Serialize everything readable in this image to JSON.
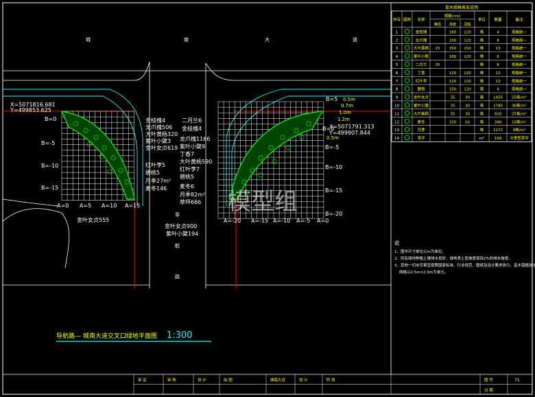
{
  "drawing": {
    "title": "导航路— 城南大道交叉口绿地平面图",
    "scale": "1:300",
    "watermark": "模型组",
    "road_label": [
      "城",
      "南",
      "大",
      "道"
    ],
    "road_label_vertical": [
      "导",
      "航",
      "路"
    ]
  },
  "left_plan": {
    "coord_x": "X=5071816.681",
    "coord_y": "Y=499853.625",
    "b_labels": [
      "B=0",
      "B=-5",
      "B=-10",
      "B=-15"
    ],
    "a_labels": [
      "A=0",
      "A=5",
      "A=10",
      "A=15"
    ],
    "dim_555": "金叶女贞555",
    "plant_callouts": [
      "金枝槐4",
      "龙爪槐506",
      "大叶黄杨320",
      "紫叶小檗3",
      "金叶女贞619",
      "红叶李5",
      "碧桃5",
      "月季27m²",
      "麦冬146"
    ]
  },
  "right_plan": {
    "coord_x": "X=5071791.313",
    "coord_y": "Y=499907.844",
    "b_labels": [
      "B=5",
      "B=0",
      "B=-5",
      "B=-10",
      "B=-15",
      "B=-20"
    ],
    "a_labels": [
      "A=-20",
      "A=-15",
      "A=-10",
      "A=-5",
      "A=0"
    ],
    "widths": [
      "0.5m",
      "0.7m",
      "1.0m",
      "1.2m",
      "0.5m"
    ],
    "plant_callouts": [
      "二月兰6",
      "金枝槐4",
      "龙爪槐1166",
      "紫叶小檗9",
      "丁香7",
      "大叶黄杨590",
      "红叶李7",
      "碧桃5",
      "麦冬6",
      "月季82m²",
      "草坪666"
    ],
    "dim_900": "金叶女贞900",
    "dim_194": "紫叶小檗194"
  },
  "legend_table": {
    "title": "苗木规格表及说明",
    "headers": [
      "序号",
      "图例",
      "名称",
      "规格(cm)",
      "单位",
      "数量",
      "备注"
    ],
    "subheaders": [
      "胸径",
      "高度",
      "冠幅"
    ],
    "rows": [
      [
        "1",
        "",
        "金枝槐",
        "",
        "180",
        "120",
        "株",
        "4",
        "规格统一"
      ],
      [
        "2",
        "",
        "龙爪槐",
        "",
        "200",
        "120",
        "株",
        "8",
        "规格统一"
      ],
      [
        "3",
        "",
        "大叶黄杨",
        "15",
        "350",
        "150",
        "株",
        "13",
        "规格统一"
      ],
      [
        "4",
        "",
        "紫叶小檗",
        "",
        "180",
        "120",
        "株",
        "6",
        "规格统一"
      ],
      [
        "5",
        "",
        "二月兰",
        "35",
        "",
        "",
        "株",
        "8",
        "规格统一"
      ],
      [
        "6",
        "",
        "丁香",
        "",
        "120",
        "120",
        "株",
        "12",
        "规格统一"
      ],
      [
        "7",
        "",
        "红叶李",
        "",
        "120",
        "120",
        "株",
        "12",
        "规格统一"
      ],
      [
        "8",
        "",
        "碧桃",
        "",
        "150",
        "120",
        "株",
        "4",
        "规格统一"
      ],
      [
        "9",
        "",
        "金叶女贞",
        "",
        "35",
        "30",
        "株",
        "1455",
        "25株/m²"
      ],
      [
        "10",
        "",
        "紫叶小檗",
        "",
        "35",
        "30",
        "株",
        "1785",
        "36株/m²"
      ],
      [
        "11",
        "",
        "大叶黄杨",
        "",
        "35",
        "30",
        "株",
        "910",
        "25株/m²"
      ],
      [
        "12",
        "",
        "麦冬",
        "",
        "150",
        "50",
        "株",
        "340",
        "16株/m²"
      ],
      [
        "13",
        "",
        "月季",
        "",
        "",
        "",
        "株",
        "1172",
        "9株/m²"
      ],
      [
        "14",
        "",
        "草坪",
        "",
        "",
        "",
        "m²",
        "109",
        "冷季型草坪"
      ]
    ]
  },
  "notes": {
    "heading": "说",
    "lines": [
      "1、图中尺寸单位以m为单位。",
      "2、所有绿地种植土壤排水良好，绿地表土层坡度保持2%的排水坡度。",
      "3、其他一切未尽事宜按照国家标准、行业规范、图纸及设计要求执行，苗木栽植技术规程。",
      "网格以2.5m×2.5m为单元。"
    ]
  },
  "title_block": {
    "cells": [
      "审 定",
      "审 核",
      "设 计",
      "绘 图",
      "城南大道",
      "设 计",
      "阶 段"
    ],
    "sheet_label": "图 号",
    "sheet_no": "71",
    "date_label": "日 期"
  },
  "colors": {
    "background": "#000000",
    "frame": "#ffffff",
    "text": "#ffff00",
    "cyan": "#00ffff",
    "red": "#ff0000",
    "green": "#00ff00"
  }
}
